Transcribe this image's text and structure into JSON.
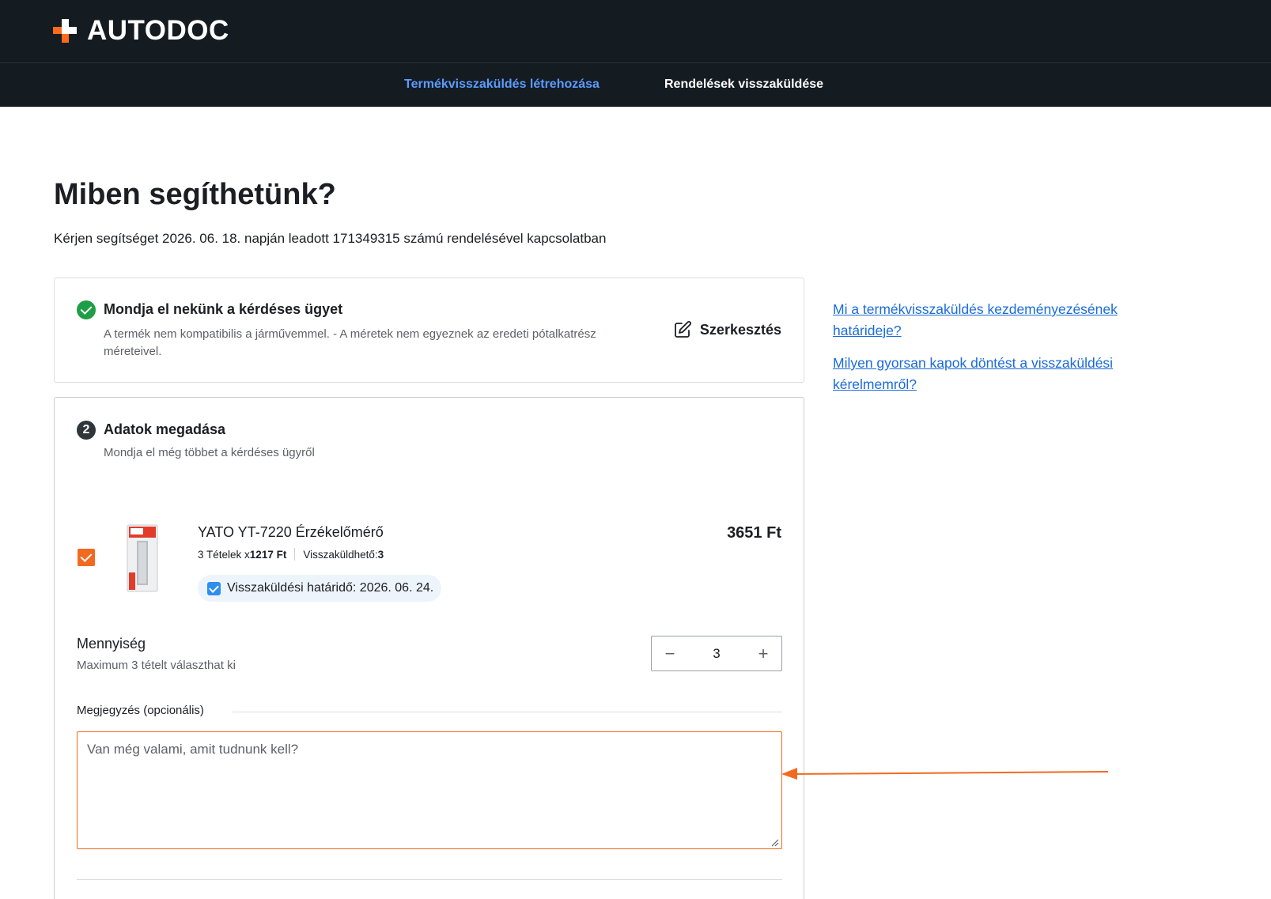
{
  "header": {
    "logo_text": "AUTODOC"
  },
  "nav": {
    "items": [
      {
        "label": "Termékvisszaküldés létrehozása"
      },
      {
        "label": "Rendelések visszaküldése"
      }
    ]
  },
  "page": {
    "title": "Miben segíthetünk?",
    "subtitle": "Kérjen segítséget 2026. 06. 18. napján leadott 171349315 számú rendelésével kapcsolatban"
  },
  "step1": {
    "title": "Mondja el nekünk a kérdéses ügyet",
    "description": "A termék nem kompatibilis a járművemmel. - A méretek nem egyeznek az eredeti pótalkatrész méreteivel.",
    "edit_label": "Szerkesztés"
  },
  "step2": {
    "number": "2",
    "title": "Adatok megadása",
    "description": "Mondja el még többet a kérdéses ügyről",
    "product": {
      "name": "YATO YT-7220 Érzékelőmérő",
      "qty_prefix": "3 Tételek x ",
      "unit_price": "1217 Ft",
      "returnable_label": "Visszaküldhető: ",
      "returnable_count": "3",
      "deadline": "Visszaküldési határidő: 2026. 06. 24.",
      "total_price": "3651 Ft",
      "selected": true
    },
    "quantity": {
      "label": "Mennyiség",
      "hint": "Maximum 3 tételt választhat ki",
      "value": "3",
      "minus": "−",
      "plus": "+"
    },
    "note": {
      "label": "Megjegyzés (opcionális)",
      "placeholder": "Van még valami, amit tudnunk kell?",
      "value": ""
    }
  },
  "faq": {
    "links": [
      {
        "label": "Mi a termékvisszaküldés kezdeményezésének határideje?"
      },
      {
        "label": "Milyen gyorsan kapok döntést a visszaküldési kérelmemről?"
      }
    ]
  },
  "colors": {
    "header_bg": "#141b21",
    "accent_orange": "#f26a1f",
    "nav_active": "#5b9bff",
    "link_blue": "#1a6bd8",
    "success_green": "#1e9e45"
  }
}
